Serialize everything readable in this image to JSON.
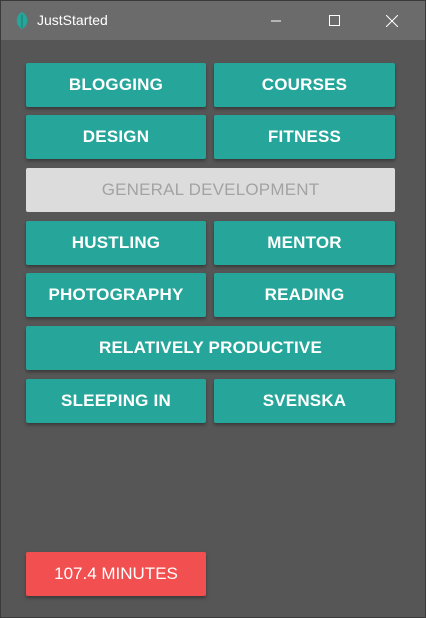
{
  "window": {
    "title": "JustStarted",
    "icon": "app-leaf-icon",
    "controls": [
      "minimize-icon",
      "maximize-icon",
      "close-icon"
    ]
  },
  "colors": {
    "accent": "#26a69a",
    "disabled_bg": "#dcdcdc",
    "disabled_text": "#a3a3a3",
    "timer": "#f25050",
    "window_bg": "#565656",
    "titlebar_bg": "#6b6b6b"
  },
  "categories": [
    {
      "label": "BLOGGING",
      "enabled": true
    },
    {
      "label": "COURSES",
      "enabled": true
    },
    {
      "label": "DESIGN",
      "enabled": true
    },
    {
      "label": "FITNESS",
      "enabled": true
    },
    {
      "label": "GENERAL DEVELOPMENT",
      "enabled": false
    },
    {
      "label": "HUSTLING",
      "enabled": true
    },
    {
      "label": "MENTOR",
      "enabled": true
    },
    {
      "label": "PHOTOGRAPHY",
      "enabled": true
    },
    {
      "label": "READING",
      "enabled": true
    },
    {
      "label": "RELATIVELY PRODUCTIVE",
      "enabled": true
    },
    {
      "label": "SLEEPING IN",
      "enabled": true
    },
    {
      "label": "SVENSKA",
      "enabled": true
    }
  ],
  "timer": {
    "label": "107.4 MINUTES"
  }
}
